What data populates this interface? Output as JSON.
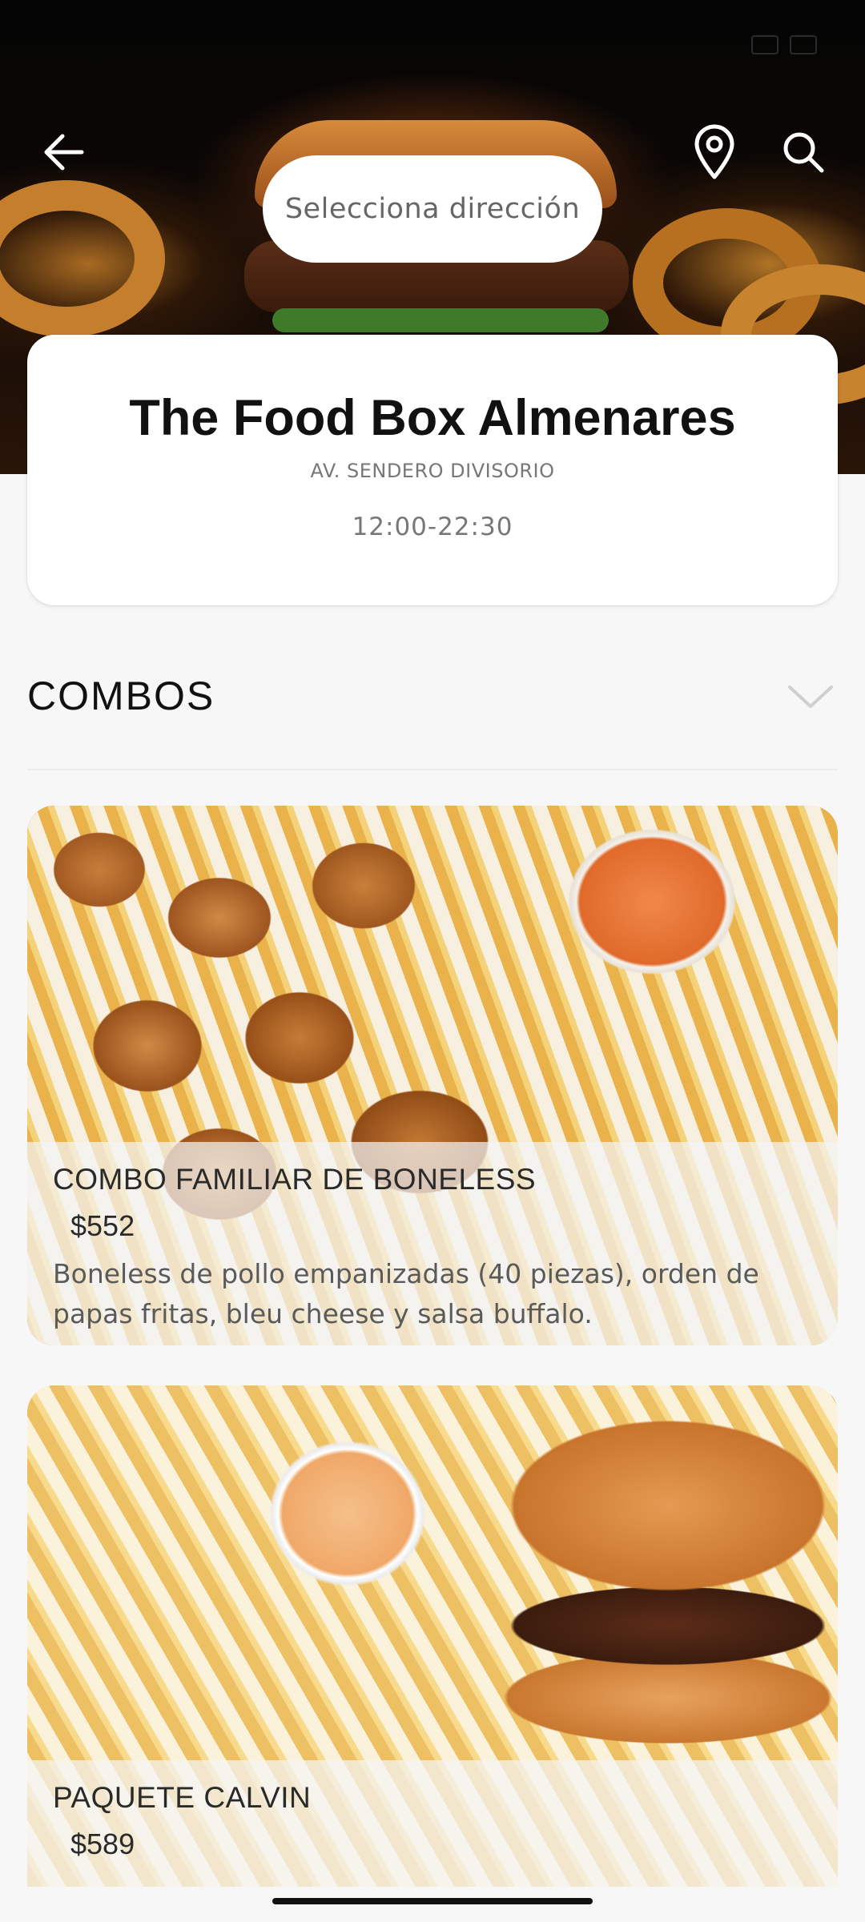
{
  "header": {
    "address_placeholder": "Selecciona dirección",
    "icons": [
      "back-arrow-icon",
      "location-pin-icon",
      "search-icon"
    ]
  },
  "restaurant": {
    "name": "The Food Box Almenares",
    "address": "AV. SENDERO DIVISORIO",
    "hours": "12:00-22:30"
  },
  "section": {
    "title": "COMBOS",
    "expand_icon": "chevron-down-icon"
  },
  "products": [
    {
      "name": "COMBO FAMILIAR DE BONELESS",
      "price": "$552",
      "description": "Boneless de pollo empanizadas (40 piezas), orden de papas fritas, bleu cheese y salsa buffalo."
    },
    {
      "name": "PAQUETE CALVIN",
      "price": "$589"
    }
  ],
  "colors": {
    "background": "#f7f7f7",
    "card": "#ffffff",
    "text_primary": "#111111",
    "text_secondary": "#777777"
  }
}
